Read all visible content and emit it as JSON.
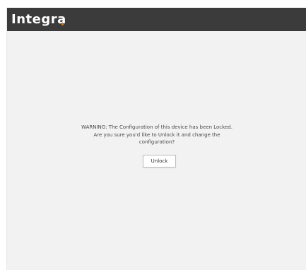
{
  "header": {
    "logo_text": "Integra",
    "logo_dot_color": "#e07a1a",
    "background_color": "#3b3b3b"
  },
  "dialog": {
    "warning_line1": "WARNING: The Configuration of this device has been Locked.",
    "warning_line2": "Are you sure you'd like to Unlock it and change the",
    "warning_line3": "configuration?",
    "unlock_label": "Unlock"
  }
}
